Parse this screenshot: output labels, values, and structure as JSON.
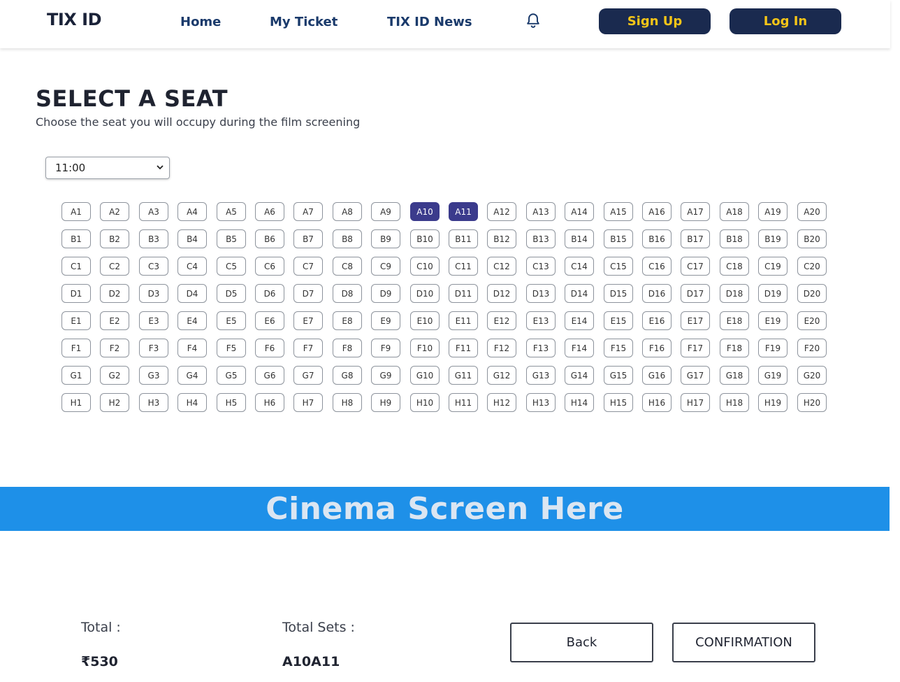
{
  "header": {
    "logo": "TIX ID",
    "nav": [
      "Home",
      "My Ticket",
      "TIX ID News"
    ],
    "bell_icon": "bell-icon",
    "signup_label": "Sign Up",
    "login_label": "Log In",
    "button_bg": "#1a2a4f",
    "button_text_color": "#f5c518"
  },
  "page": {
    "title": "SELECT A SEAT",
    "subtitle": "Choose the seat you will occupy during the film screening"
  },
  "showtime": {
    "selected": "11:00"
  },
  "seats": {
    "rows": [
      "A",
      "B",
      "C",
      "D",
      "E",
      "F",
      "G",
      "H"
    ],
    "count_per_row": 20,
    "selected": [
      "A10",
      "A11"
    ],
    "selected_color": "#3b3b8c"
  },
  "screen": {
    "label": "Cinema Screen Here",
    "color": "#1e90e8"
  },
  "footer": {
    "total_label": "Total :",
    "total_value": "₹530",
    "sets_label": "Total Sets :",
    "sets_value": "A10A11",
    "back_label": "Back",
    "confirm_label": "CONFIRMATION"
  }
}
